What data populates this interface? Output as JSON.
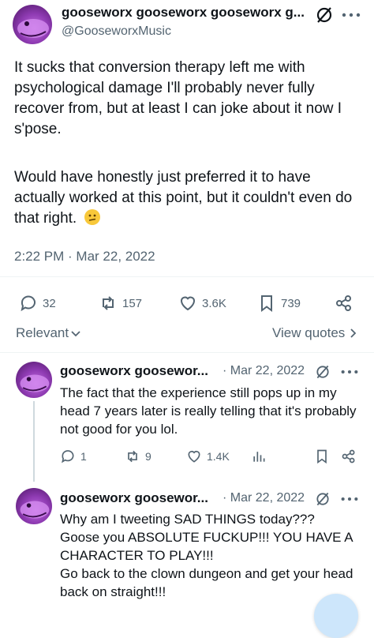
{
  "tweet": {
    "display_name": "gooseworx gooseworx gooseworx g...",
    "handle": "@GooseworxMusic",
    "text_p1": "It sucks that conversion therapy left me with psychological damage I'll probably never fully recover from, but at least I can joke about it now I s'pose.",
    "text_p2": "Would have honestly just preferred it to have actually worked at this point, but it couldn't even do that right.",
    "emoji": "confused-face",
    "timestamp": "2:22 PM · Mar 22, 2022",
    "stats": {
      "replies": "32",
      "reposts": "157",
      "likes": "3.6K",
      "bookmarks": "739"
    }
  },
  "filter": {
    "sort_label": "Relevant",
    "view_quotes": "View quotes"
  },
  "replies": [
    {
      "display_name": "gooseworx goosewor...",
      "date": "· Mar 22, 2022",
      "text": "The fact that the experience still pops up in my head 7 years later is really telling that it's probably not good for you lol.",
      "stats": {
        "replies": "1",
        "reposts": "9",
        "likes": "1.4K"
      }
    },
    {
      "display_name": "gooseworx goosewor...",
      "date": "· Mar 22, 2022",
      "text_lines": [
        "Why am I tweeting SAD THINGS today???",
        "Goose you ABSOLUTE FUCKUP!!! YOU HAVE A CHARACTER TO PLAY!!!",
        "Go back to the clown dungeon and get your head back on straight!!!"
      ]
    }
  ],
  "colors": {
    "text": "#0f1419",
    "muted": "#536471",
    "divider": "#eff3f4",
    "avatar": "#9b4bc0"
  }
}
